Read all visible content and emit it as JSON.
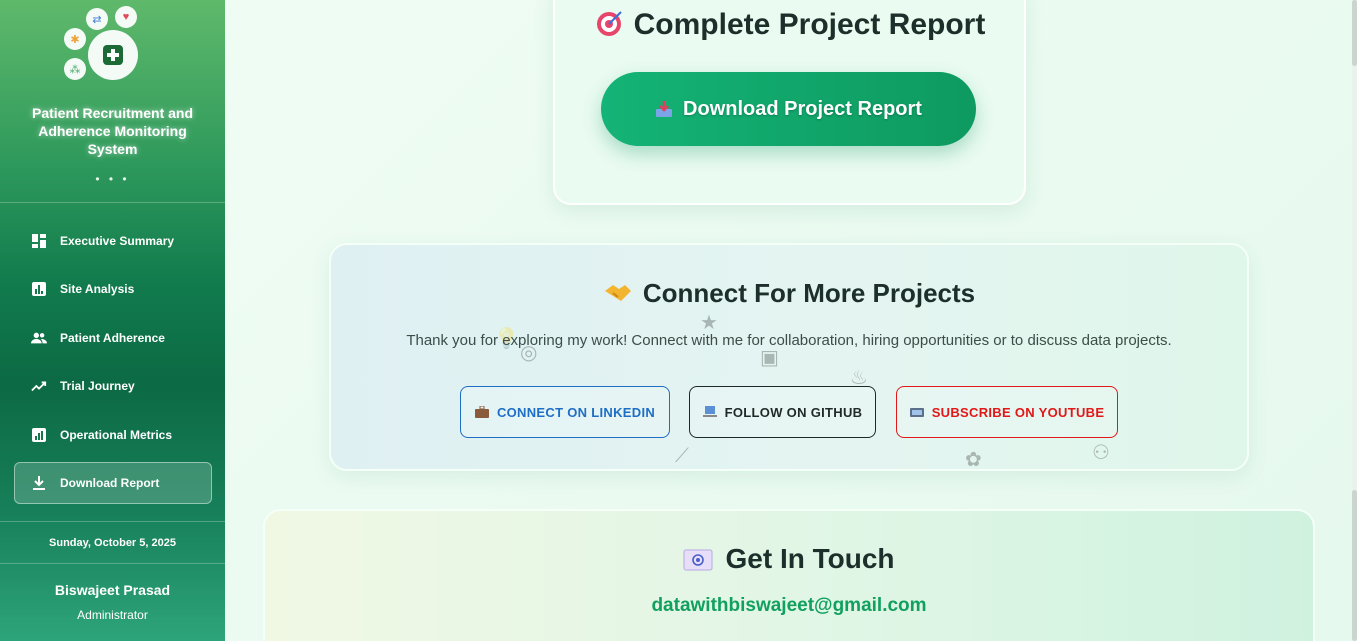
{
  "sidebar": {
    "app_title": "Patient Recruitment and Adherence Monitoring System",
    "dots": "• • •",
    "nav": [
      {
        "label": "Executive Summary",
        "icon": "dashboard-icon"
      },
      {
        "label": "Site Analysis",
        "icon": "bar-chart-icon"
      },
      {
        "label": "Patient Adherence",
        "icon": "people-icon"
      },
      {
        "label": "Trial Journey",
        "icon": "trending-up-icon"
      },
      {
        "label": "Operational Metrics",
        "icon": "analytics-icon"
      },
      {
        "label": "Download Report",
        "icon": "download-icon",
        "active": true
      }
    ],
    "date": "Sunday, October 5, 2025",
    "user": {
      "name": "Biswajeet Prasad",
      "role": "Administrator"
    }
  },
  "report": {
    "title": "Complete Project Report",
    "button": "Download Project Report"
  },
  "connect": {
    "title": "Connect For More Projects",
    "text": "Thank you for exploring my work! Connect with me for collaboration, hiring opportunities or to discuss data projects.",
    "buttons": {
      "linkedin": "CONNECT ON LINKEDIN",
      "github": "FOLLOW ON GITHUB",
      "youtube": "SUBSCRIBE ON YOUTUBE"
    }
  },
  "touch": {
    "title": "Get In Touch",
    "email": "datawithbiswajeet@gmail.com"
  },
  "colors": {
    "accent": "#12a05f",
    "linkedin": "#1e6ec6",
    "youtube": "#e01818",
    "sidebar_dark": "#0c6a44"
  }
}
